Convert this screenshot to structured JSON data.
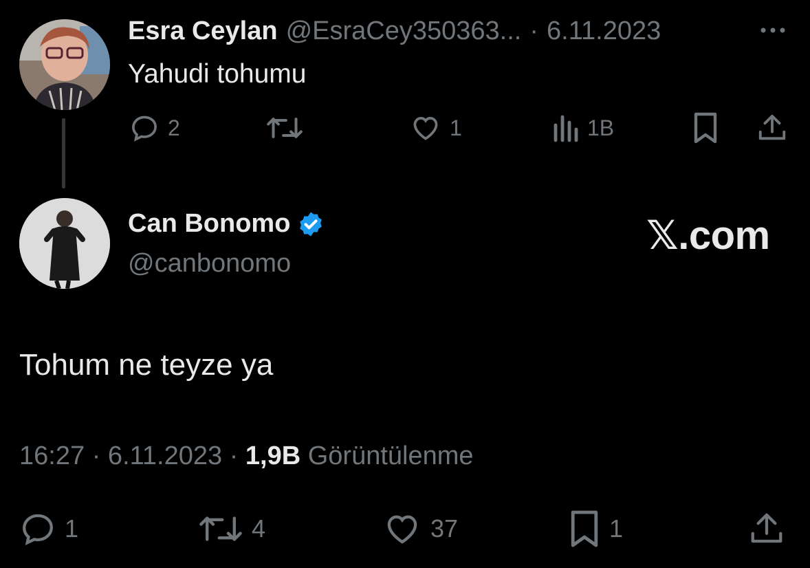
{
  "parent_tweet": {
    "author_name": "Esra Ceylan",
    "author_handle": "@EsraCey350363...",
    "separator": "·",
    "date": "6.11.2023",
    "text": "Yahudi tohumu",
    "actions": {
      "reply_count": "2",
      "like_count": "1",
      "views_count": "1B"
    }
  },
  "main_tweet": {
    "author_name": "Can Bonomo",
    "author_handle": "@canbonomo",
    "verified": true,
    "text": "Tohum ne teyze ya",
    "meta": {
      "time": "16:27",
      "sep1": "·",
      "date": "6.11.2023",
      "sep2": "·",
      "views": "1,9B",
      "views_label": "Görüntülenme"
    },
    "actions": {
      "reply_count": "1",
      "retweet_count": "4",
      "like_count": "37",
      "bookmark_count": "1"
    }
  },
  "brand": {
    "x_glyph": "𝕏",
    "domain": ".com"
  },
  "colors": {
    "background": "#000000",
    "text_primary": "#e7e9ea",
    "text_muted": "#71767b",
    "verified_blue": "#1d9bf0",
    "thread_line": "#333639"
  }
}
